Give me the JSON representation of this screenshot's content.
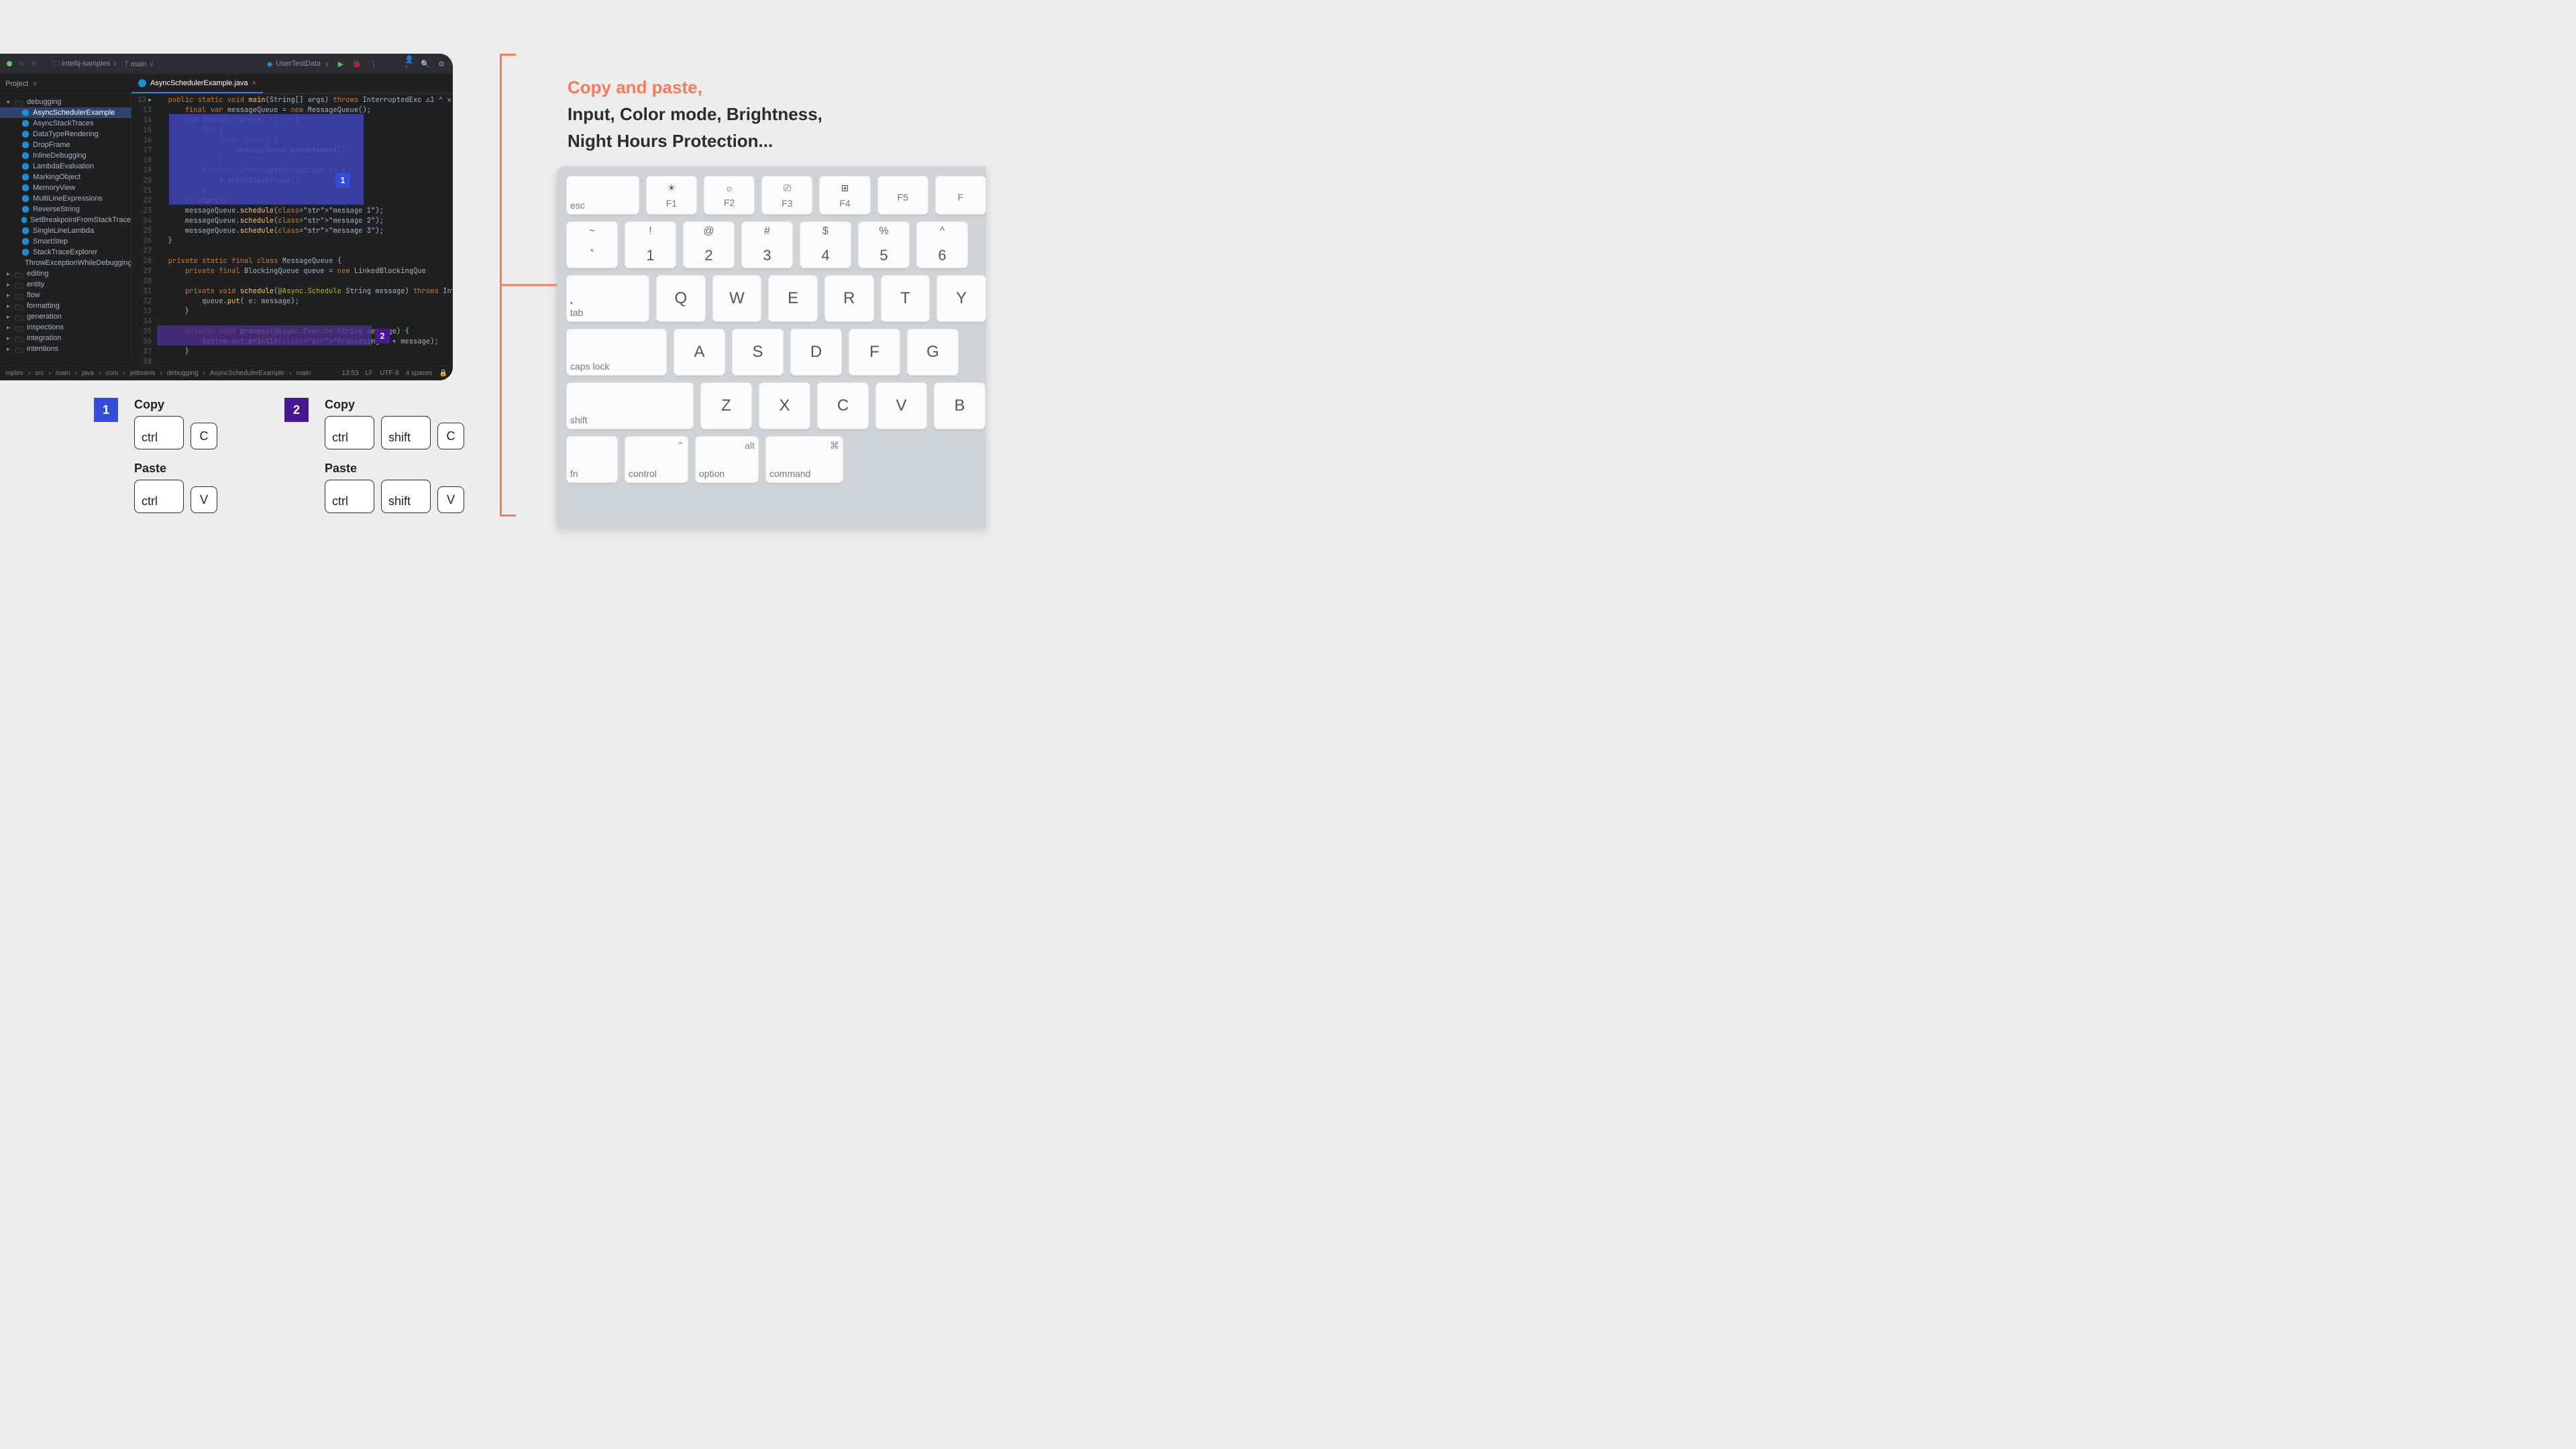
{
  "ide": {
    "titlebar": {
      "project": "intellij-samples",
      "branch": "main",
      "run_config": "UserTestData"
    },
    "project_label": "Project",
    "tree": {
      "root": "debugging",
      "items": [
        "AsyncSchedulerExample",
        "AsyncStackTraces",
        "DataTypeRendering",
        "DropFrame",
        "InlineDebugging",
        "LambdaEvaluation",
        "MarkingObject",
        "MemoryView",
        "MultiLineExpressions",
        "ReverseString",
        "SetBreakpointFromStackTrace",
        "SingleLineLambda",
        "SmartStep",
        "StackTraceExplorer",
        "ThrowExceptionWhileDebugging"
      ],
      "folders": [
        "editing",
        "entity",
        "flow",
        "formatting",
        "generation",
        "inspections",
        "integration",
        "intentions"
      ]
    },
    "tab": "AsyncSchedulerExample.java",
    "gutter_start": 12,
    "gutter_end": 38,
    "code": [
      "public static void main(String[] args) throws InterruptedExc ⚠1 ^ ∨",
      "    final var messageQueue = new MessageQueue();",
      "    new Thread( target: () -> {",
      "        try {",
      "            while (true) {",
      "                messageQueue.processNext();",
      "            }",
      "        } catch (InterruptedException e) {",
      "            e.printStackTrace();",
      "        }",
      "    }).start();",
      "    messageQueue.schedule(\"message 1\");",
      "    messageQueue.schedule(\"message 2\");",
      "    messageQueue.schedule(\"message 3\");",
      "}",
      "",
      "private static final class MessageQueue {",
      "    private final BlockingQueue<String> queue = new LinkedBlockingQue",
      "",
      "    private void schedule(@Async.Schedule String message) throws Inte",
      "        queue.put( e: message);",
      "    }",
      "",
      "    private void process(@Async.Execute String message) {",
      "        System.out.println(\"Processing \" + message);",
      "    }"
    ],
    "breadcrumbs": [
      "mples",
      "src",
      "main",
      "java",
      "com",
      "jetbrains",
      "debugging",
      "AsyncSchedulerExample",
      "main"
    ],
    "status": {
      "time": "13:53",
      "lf": "LF",
      "enc": "UTF-8",
      "indent": "4 spaces"
    }
  },
  "callouts": {
    "copy_label": "Copy",
    "paste_label": "Paste",
    "ctrl": "ctrl",
    "shift": "shift",
    "c": "C",
    "v": "V"
  },
  "promo": {
    "line1": "Copy and paste,",
    "line2": "Input, Color mode, Brightness,",
    "line3": "Night Hours Protection..."
  },
  "keyboard": {
    "esc": "esc",
    "frow": [
      "F1",
      "F2",
      "F3",
      "F4",
      "F5",
      "F"
    ],
    "fsym": [
      "☀︎",
      "☼",
      "⎚",
      "⊞",
      "",
      ""
    ],
    "num_top": [
      "~",
      "!",
      "@",
      "#",
      "$",
      "%",
      "^"
    ],
    "num_bot": [
      "`",
      "1",
      "2",
      "3",
      "4",
      "5",
      "6"
    ],
    "tab": "tab",
    "qrow": [
      "Q",
      "W",
      "E",
      "R",
      "T",
      "Y"
    ],
    "caps": "caps lock",
    "arow": [
      "A",
      "S",
      "D",
      "F",
      "G"
    ],
    "shift": "shift",
    "zrow": [
      "Z",
      "X",
      "C",
      "V",
      "B"
    ],
    "mods": {
      "fn": "fn",
      "control": "control",
      "option": "option",
      "command": "command",
      "alt": "alt",
      "cmd": "⌘",
      "ctl": "⌃"
    }
  }
}
